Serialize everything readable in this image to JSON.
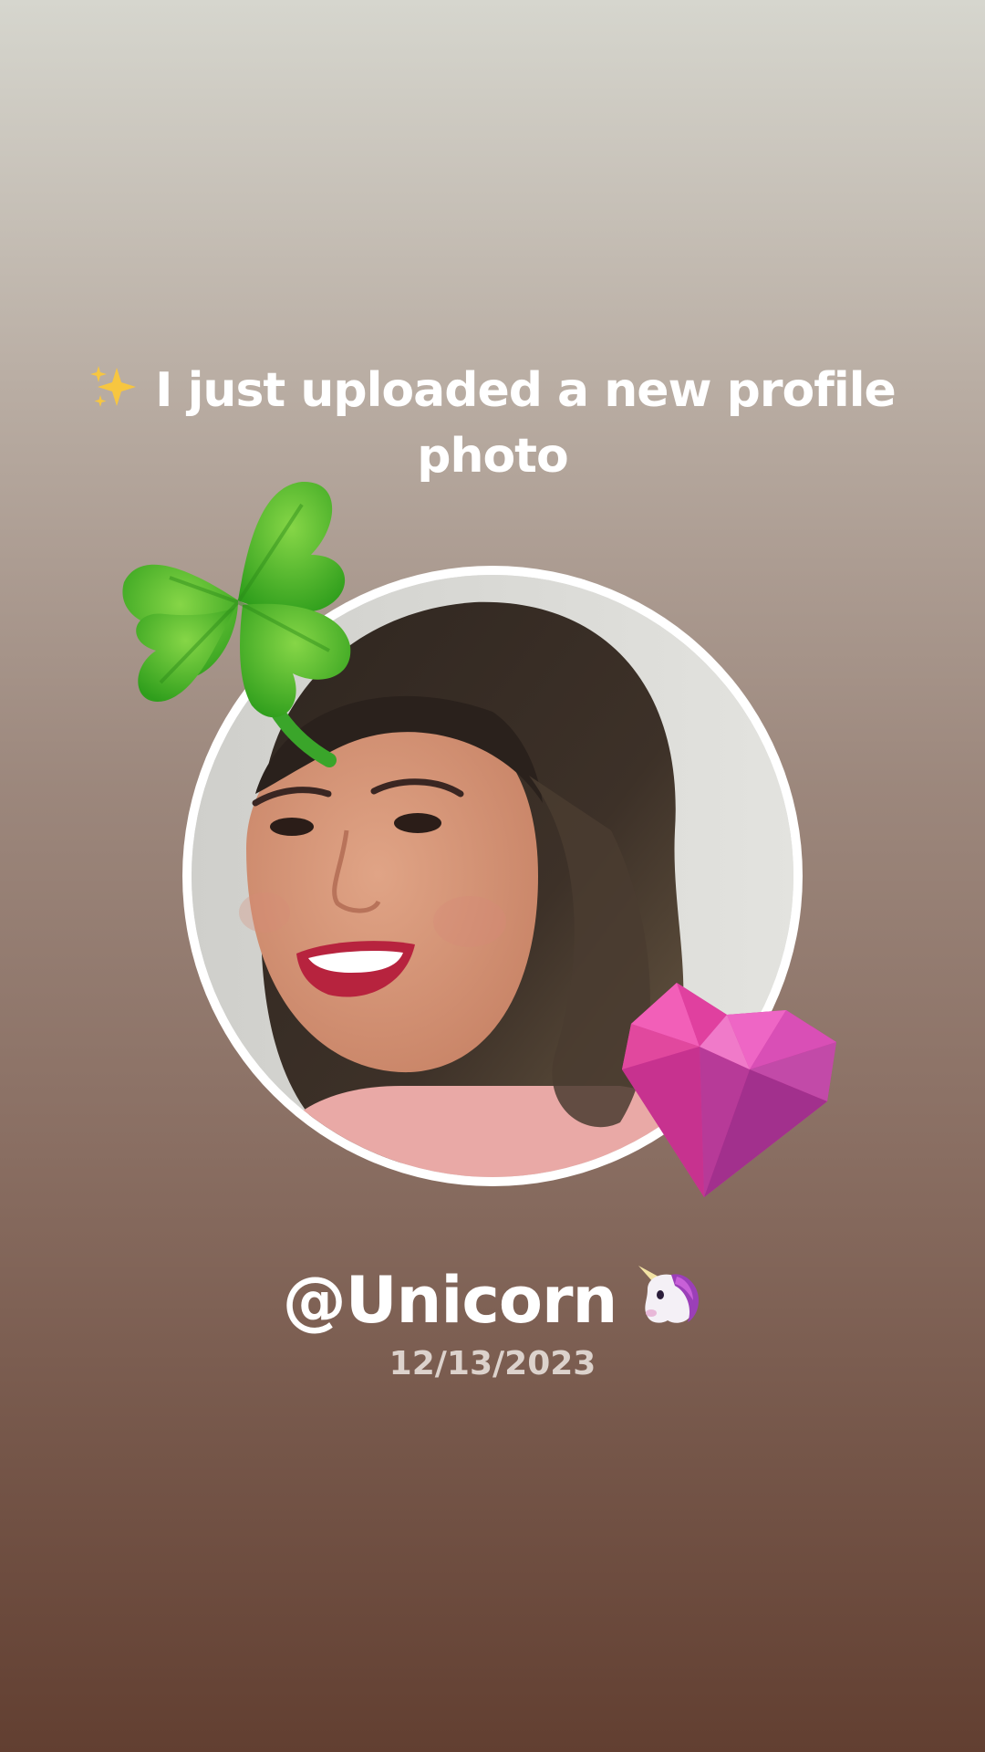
{
  "post": {
    "headline": "I just uploaded a new profile photo",
    "username": "@Unicorn",
    "date": "12/13/2023"
  },
  "icons": {
    "headline_prefix": "sparkles-icon",
    "username_suffix": "unicorn-icon",
    "decoration_top_left": "four-leaf-clover-icon",
    "decoration_bottom_right": "pink-gem-heart-icon"
  },
  "colors": {
    "background_top": "#d6d6ce",
    "background_bottom": "#623f31",
    "text": "#ffffff",
    "date_text": "#dcd2cc",
    "frame": "#ffffff"
  }
}
